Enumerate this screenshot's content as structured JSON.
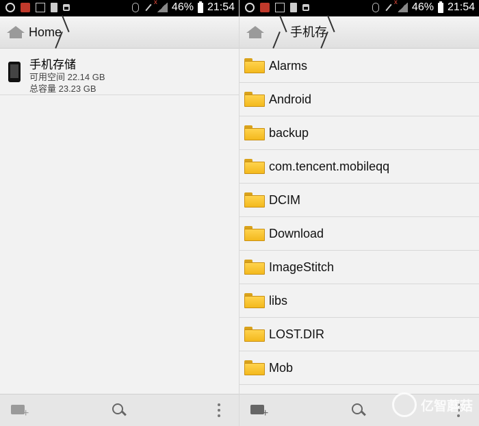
{
  "status_bar": {
    "battery_percent": "46%",
    "time": "21:54"
  },
  "left_panel": {
    "breadcrumb": [
      "Home"
    ],
    "storage": {
      "name": "手机存储",
      "available": "可用空间 22.14 GB",
      "total": "总容量 23.23 GB"
    },
    "bottom_bar": {
      "icons": [
        "new-folder-icon",
        "search-icon",
        "more-icon"
      ]
    }
  },
  "right_panel": {
    "breadcrumb": [
      "手机存"
    ],
    "folders": [
      {
        "name": "Alarms"
      },
      {
        "name": "Android"
      },
      {
        "name": "backup"
      },
      {
        "name": "com.tencent.mobileqq"
      },
      {
        "name": "DCIM"
      },
      {
        "name": "Download"
      },
      {
        "name": "ImageStitch"
      },
      {
        "name": "libs"
      },
      {
        "name": "LOST.DIR"
      },
      {
        "name": "Mob"
      }
    ],
    "bottom_bar": {
      "icons": [
        "new-folder-icon",
        "search-icon",
        "more-icon"
      ]
    }
  },
  "watermark": {
    "text": "亿智蘑菇"
  }
}
